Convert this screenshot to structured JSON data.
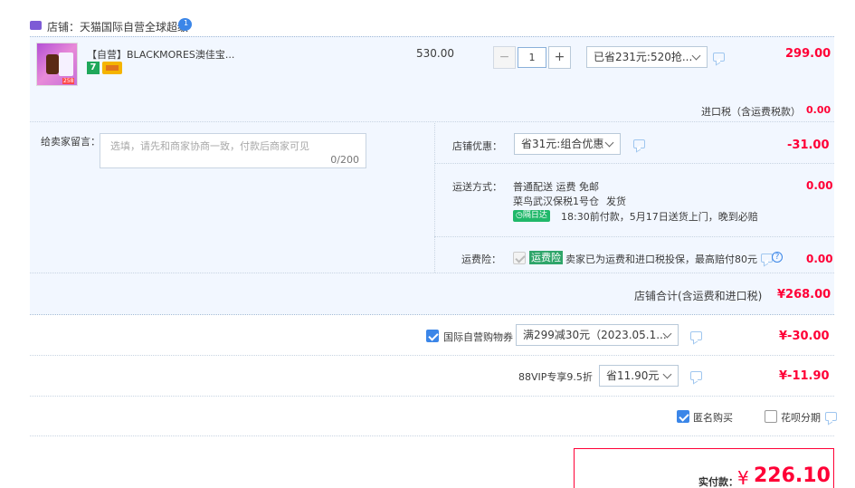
{
  "shop": {
    "label": "店铺：",
    "name": "天猫国际自营全球超级",
    "badge_icon": "tmall-global-icon",
    "chat_icon": "chat-bubble-icon"
  },
  "product": {
    "title": "【自营】BLACKMORES澳佳宝...",
    "price": "530.00",
    "quantity": "1",
    "discount_select": "已省231元:520抢...",
    "subtotal": "299.00",
    "badge_7": "7",
    "thumb_price": "258"
  },
  "import_tax": {
    "label": "进口税（含运费税款）",
    "value": "0.00"
  },
  "message": {
    "label": "给卖家留言：",
    "placeholder": "选填，请先和商家协商一致，付款后商家可见",
    "counter": "0/200"
  },
  "shop_discount": {
    "label": "店铺优惠：",
    "select": "省31元:组合优惠",
    "value": "-31.00"
  },
  "shipping": {
    "label": "运送方式：",
    "method": "普通配送 运费 免邮",
    "warehouse": "菜鸟武汉保税1号仓",
    "ship_note": "发货",
    "tag": "隔日达",
    "delivery": "18:30前付款，5月17日送货上门，晚到必赔",
    "value": "0.00"
  },
  "insurance": {
    "label": "运费险：",
    "tag": "运费险",
    "text": "卖家已为运费和进口税投保，最高赔付80元",
    "value": "0.00"
  },
  "shop_total": {
    "label": "店铺合计(含运费和进口税)",
    "value": "¥268.00"
  },
  "coupon": {
    "label": "国际自营购物券",
    "select": "满299减30元（2023.05.1...",
    "value": "¥-30.00"
  },
  "vip": {
    "label": "88VIP专享9.5折",
    "select": "省11.90元",
    "value": "¥-11.90"
  },
  "options": {
    "anonymous": "匿名购买",
    "huabei": "花呗分期"
  },
  "payment": {
    "label": "实付款：",
    "currency": "¥",
    "amount": "226.10"
  },
  "colors": {
    "accent": "#ff0036",
    "panel": "#f2f7ff",
    "border": "#b9c9d9"
  }
}
